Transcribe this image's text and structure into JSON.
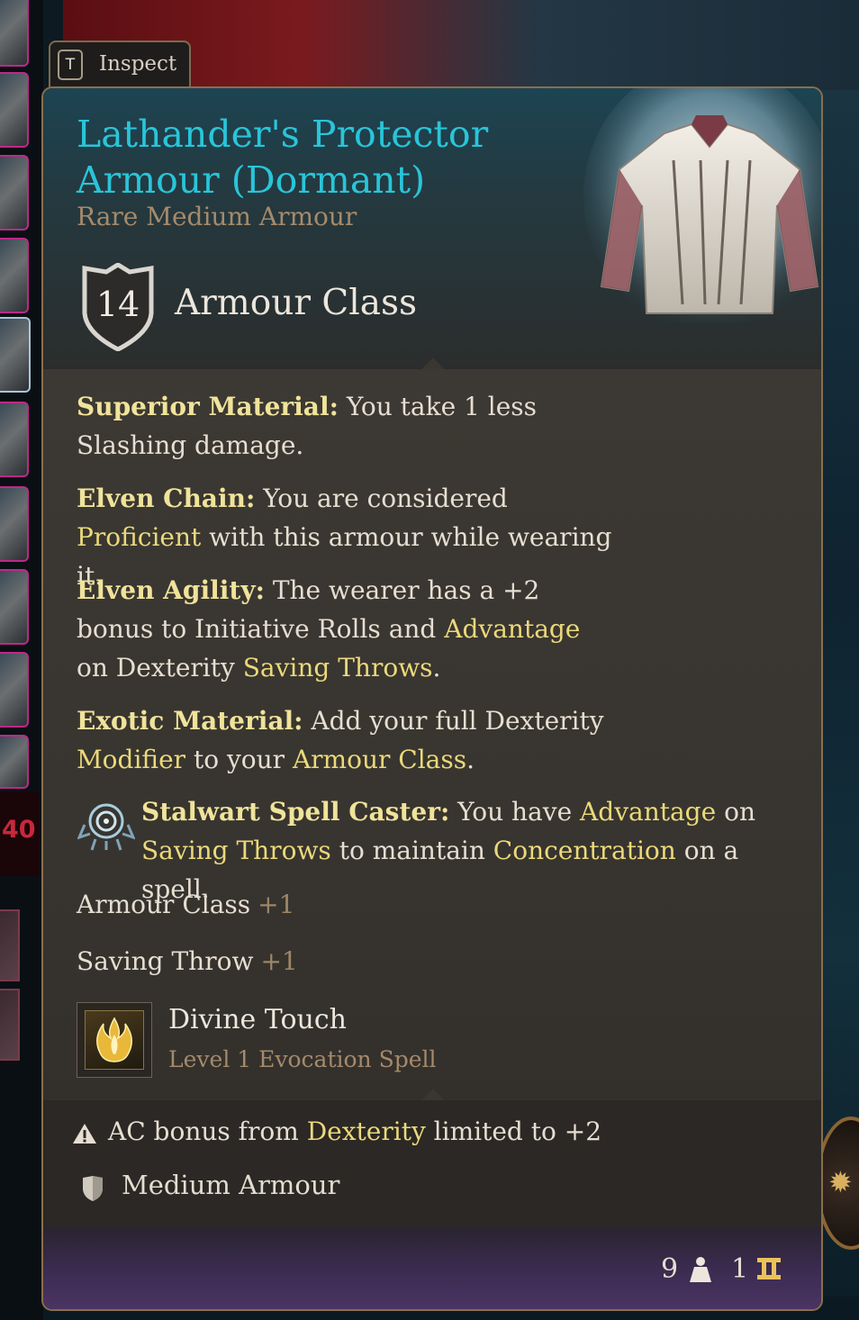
{
  "inspect": {
    "key": "T",
    "label": "Inspect"
  },
  "item": {
    "name": "Lathander's Protector Armour (Dormant)",
    "rarity_type": "Rare Medium Armour",
    "armour_class_value": "14",
    "armour_class_label": "Armour Class"
  },
  "properties": [
    {
      "key": "Superior Material:",
      "parts": [
        " You take 1 less Slashing damage."
      ]
    },
    {
      "key": "Elven Chain:",
      "parts": [
        " You are considered ",
        "Proficient",
        " with this armour while wearing it."
      ]
    },
    {
      "key": "Elven Agility:",
      "parts": [
        " The wearer has a +2 bonus to Initiative Rolls and ",
        "Advantage",
        " on Dexterity ",
        "Saving Throws",
        "."
      ]
    },
    {
      "key": "Exotic Material:",
      "parts": [
        " Add your full Dexterity ",
        "Modifier",
        " to your ",
        "Armour Class",
        "."
      ]
    },
    {
      "key": "Stalwart Spell Caster:",
      "parts": [
        " You have ",
        "Advantage",
        " on ",
        "Saving Throws",
        " to maintain ",
        "Concentration",
        " on a spell."
      ]
    }
  ],
  "stats": [
    {
      "label": "Armour Class",
      "value": "+1"
    },
    {
      "label": "Saving Throw",
      "value": "+1"
    }
  ],
  "spell": {
    "name": "Divine Touch",
    "subtitle": "Level 1 Evocation Spell",
    "icon": "divine-flame-icon"
  },
  "footer": {
    "warning_parts": [
      "AC bonus from ",
      "Dexterity",
      " limited to +2"
    ],
    "proficiency_label": "Medium Armour"
  },
  "bottom": {
    "weight": "9",
    "value": "1"
  },
  "side": {
    "number": "40"
  },
  "colors": {
    "title": "#29c5d9",
    "keyword": "#f0e39a",
    "highlight": "#ebd97a",
    "subtitle": "#a58a6b",
    "border": "#8a6f4c"
  }
}
